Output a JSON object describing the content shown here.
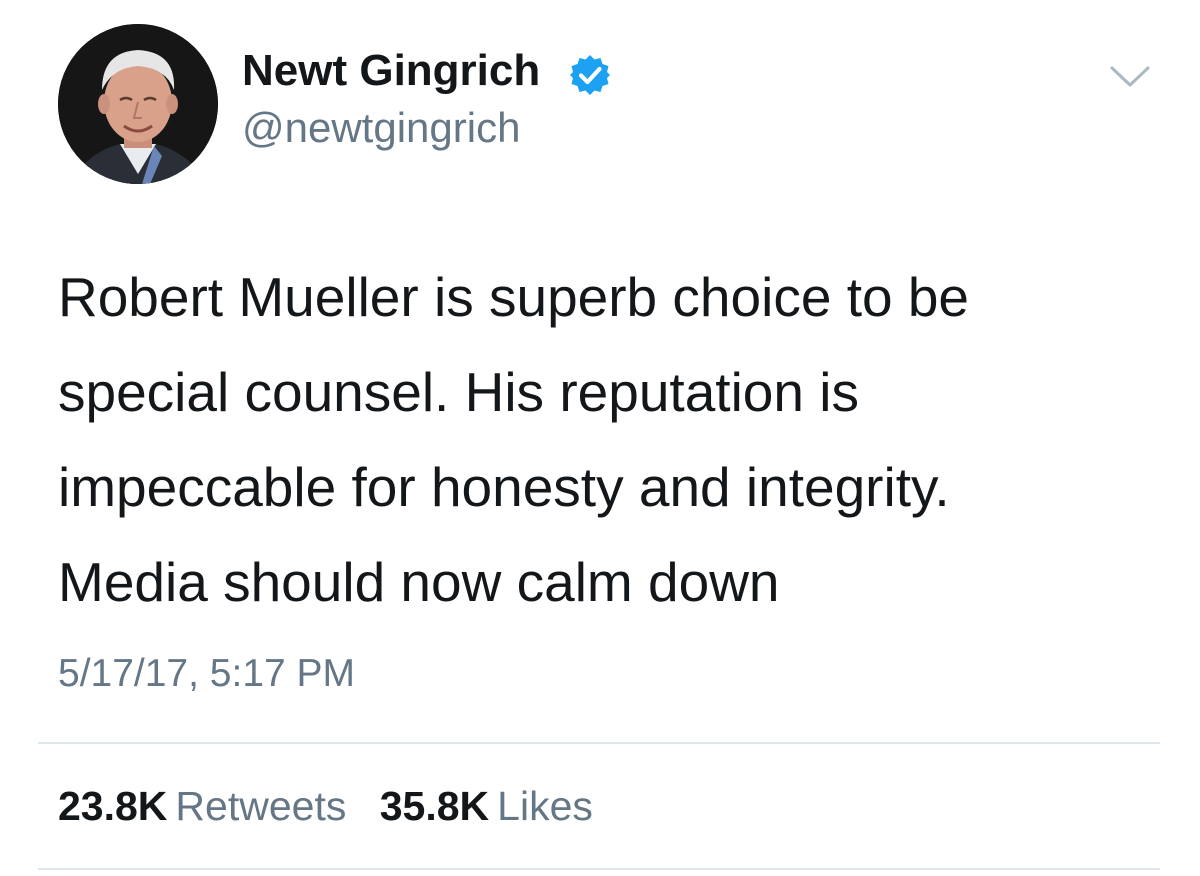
{
  "user": {
    "display_name": "Newt Gingrich",
    "handle": "@newtgingrich",
    "verified": true,
    "avatar_icon": "profile-photo"
  },
  "tweet": {
    "text_lines": [
      "Robert Mueller is superb choice to be",
      "special counsel. His reputation is",
      "impeccable for honesty and integrity.",
      "Media should now calm down"
    ],
    "timestamp": "5/17/17, 5:17 PM"
  },
  "stats": {
    "retweets_count": "23.8K",
    "retweets_label": "Retweets",
    "likes_count": "35.8K",
    "likes_label": "Likes"
  },
  "colors": {
    "primary_text": "#14171a",
    "secondary_text": "#657786",
    "verified_blue": "#1da1f2",
    "divider": "#e1e8ed"
  }
}
